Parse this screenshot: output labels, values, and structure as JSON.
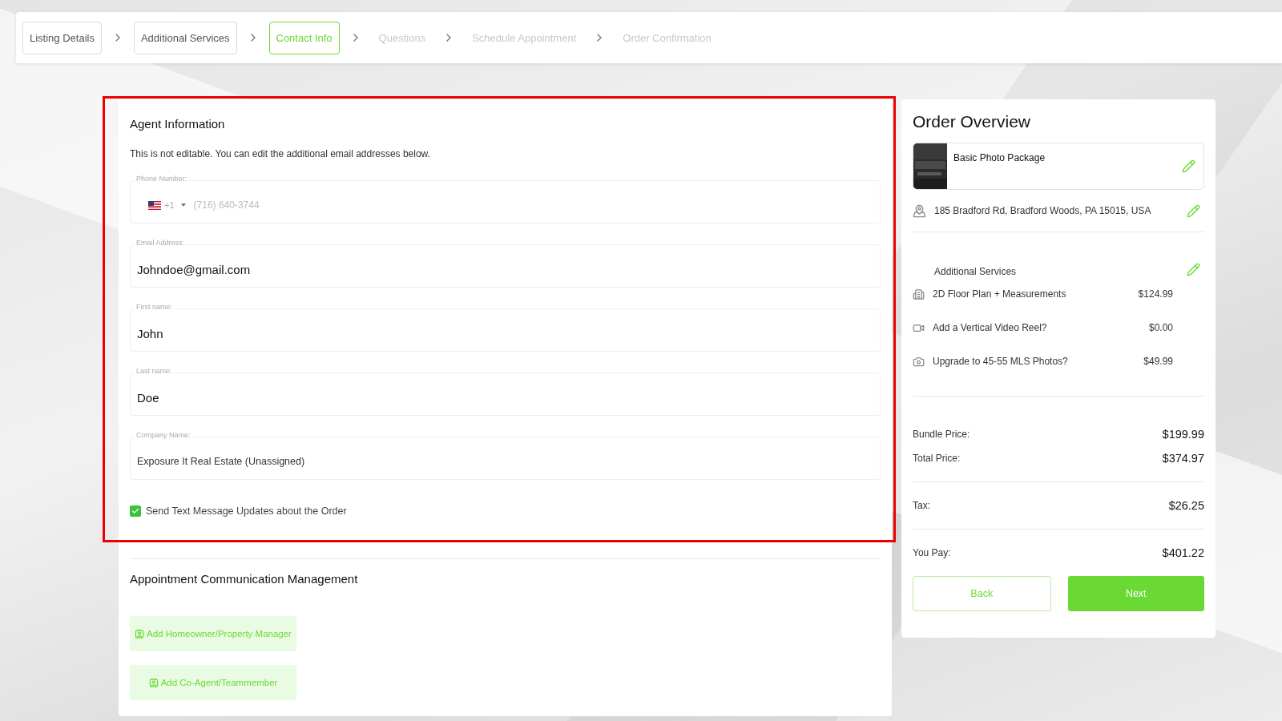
{
  "steps": [
    {
      "label": "Listing Details",
      "selected": false,
      "completed": true
    },
    {
      "label": "Additional Services",
      "selected": false,
      "completed": true
    },
    {
      "label": "Contact Info",
      "selected": true,
      "completed": false
    },
    {
      "label": "Questions",
      "selected": false,
      "completed": false
    },
    {
      "label": "Schedule Appointment",
      "selected": false,
      "completed": false
    },
    {
      "label": "Order Confirmation",
      "selected": false,
      "completed": false
    }
  ],
  "agent_information": {
    "highlighted": true,
    "title": "Agent Information",
    "note": "This is not editable. You can edit the additional email addresses below.",
    "phone": {
      "label": "Phone Number:",
      "country_code": "+1",
      "value": "(716) 640-3744",
      "disabled": true
    },
    "fields": [
      {
        "label": "Email Address:",
        "value": "Johndoe@gmail.com",
        "kind": "large"
      },
      {
        "label": "First name:",
        "value": "John",
        "kind": "large"
      },
      {
        "label": "Last name:",
        "value": "Doe",
        "kind": "large"
      },
      {
        "label": "Company Name:",
        "value": "Exposure It Real Estate (Unassigned)",
        "kind": "small"
      }
    ],
    "sms_updates": {
      "label": "Send Text Message Updates about the Order",
      "checked": true
    }
  },
  "appointment_communication": {
    "title": "Appointment Communication Management",
    "buttons": [
      "Add Homeowner/Property Manager",
      "Add Co-Agent/Teammember"
    ]
  },
  "order_overview": {
    "title": "Order Overview",
    "package": {
      "name": "Basic Photo Package"
    },
    "address": "185 Bradford Rd, Bradford Woods, PA 15015, USA",
    "additional_services_title": "Additional Services",
    "services": [
      {
        "name": "2D Floor Plan + Measurements",
        "price": "$124.99"
      },
      {
        "name": "Add a Vertical Video Reel?",
        "price": "$0.00"
      },
      {
        "name": "Upgrade to 45-55 MLS Photos?",
        "price": "$49.99"
      }
    ],
    "total_groups": [
      [
        {
          "label": "Bundle Price:",
          "value": "$199.99"
        },
        {
          "label": "Total Price:",
          "value": "$374.97"
        }
      ],
      [
        {
          "label": "Tax:",
          "value": "$26.25"
        }
      ],
      [
        {
          "label": "You Pay:",
          "value": "$401.22"
        }
      ]
    ],
    "back_button": "Back",
    "next_button": "Next"
  }
}
